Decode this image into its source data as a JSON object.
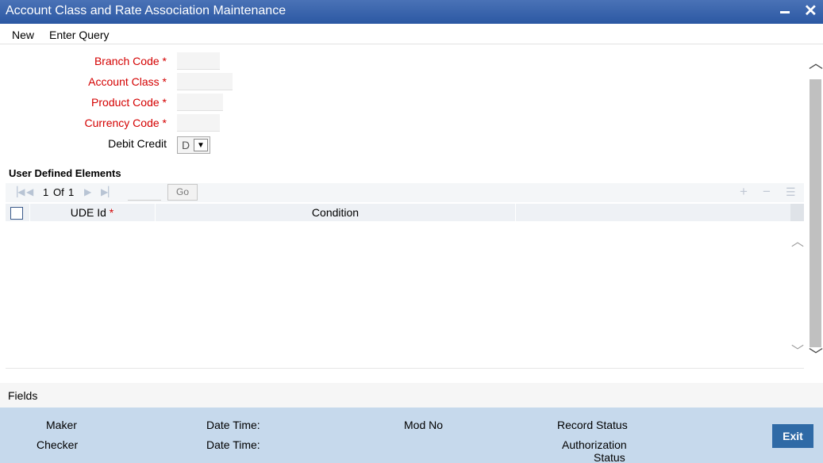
{
  "window": {
    "title": "Account Class and Rate Association Maintenance",
    "minimize_icon": "minimize-icon",
    "close_icon": "close-icon"
  },
  "menu": {
    "new_label": "New",
    "enter_query_label": "Enter Query"
  },
  "form": {
    "branch_code_label": "Branch Code",
    "branch_code_value": "",
    "account_class_label": "Account Class",
    "account_class_value": "",
    "product_code_label": "Product Code",
    "product_code_value": "",
    "currency_code_label": "Currency Code",
    "currency_code_value": "",
    "debit_credit_label": "Debit Credit",
    "debit_credit_value": "D",
    "required_marker": "*"
  },
  "udf": {
    "section_title": "User Defined Elements",
    "page_current": "1",
    "page_of": "Of",
    "page_total": "1",
    "go_label": "Go",
    "columns": [
      "UDE Id",
      "Condition"
    ],
    "rows": []
  },
  "fields_label": "Fields",
  "footer": {
    "maker_label": "Maker",
    "checker_label": "Checker",
    "date_time_label_1": "Date Time:",
    "date_time_label_2": "Date Time:",
    "mod_no_label": "Mod No",
    "record_status_label": "Record Status",
    "authorization_label": "Authorization",
    "status_label": "Status",
    "exit_label": "Exit"
  },
  "colors": {
    "titlebar": "#2c58a3",
    "required": "#d40000",
    "footer": "#c6d9ec",
    "exit_button": "#2f6aa6"
  }
}
